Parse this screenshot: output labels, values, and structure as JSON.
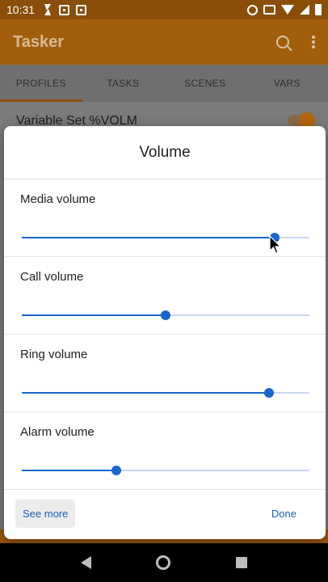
{
  "status_bar": {
    "time": "10:31",
    "icons_left": [
      "bolt-icon",
      "tasker-notification-icon",
      "tasker-notification-icon"
    ],
    "icons_right": [
      "alarm-icon",
      "cast-icon",
      "wifi-icon",
      "signal-icon",
      "battery-icon"
    ]
  },
  "app": {
    "title": "Tasker",
    "tabs": [
      "PROFILES",
      "TASKS",
      "SCENES",
      "VARS"
    ],
    "active_tab": "PROFILES",
    "profile_row": "Variable Set %VOLM",
    "accent_color": "#b5660c"
  },
  "dialog": {
    "title": "Volume",
    "sliders": [
      {
        "label": "Media volume",
        "level": 0.88
      },
      {
        "label": "Call volume",
        "level": 0.5
      },
      {
        "label": "Ring volume",
        "level": 0.86
      },
      {
        "label": "Alarm volume",
        "level": 0.33
      }
    ],
    "see_more": "See more",
    "done": "Done",
    "slider_color": "#1a66cc"
  },
  "nav": {
    "icons": [
      "back-icon",
      "home-icon",
      "recents-icon"
    ]
  }
}
